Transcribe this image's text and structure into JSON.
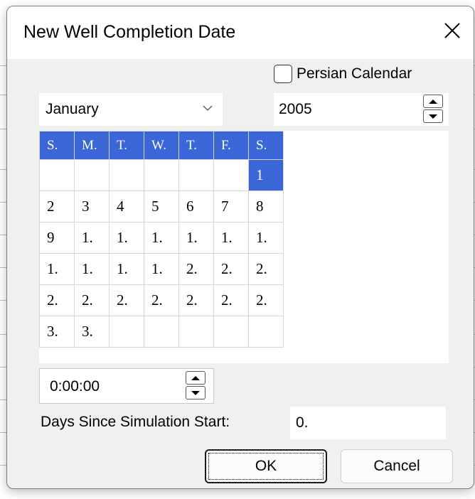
{
  "dialog": {
    "title": "New Well Completion Date",
    "close_icon": "close-icon"
  },
  "persian_calendar": {
    "label": "Persian Calendar",
    "checked": false
  },
  "month": {
    "value": "January",
    "icon": "chevron-down-icon"
  },
  "year": {
    "value": "2005",
    "up_icon": "spin-up-icon",
    "down_icon": "spin-down-icon"
  },
  "calendar": {
    "weekdays": [
      "S.",
      "M.",
      "T.",
      "W.",
      "T.",
      "F.",
      "S."
    ],
    "weeks": [
      [
        "",
        "",
        "",
        "",
        "",
        "",
        "1"
      ],
      [
        "2",
        "3",
        "4",
        "5",
        "6",
        "7",
        "8"
      ],
      [
        "9",
        "1.",
        "1.",
        "1.",
        "1.",
        "1.",
        "1."
      ],
      [
        "1.",
        "1.",
        "1.",
        "1.",
        "2.",
        "2.",
        "2."
      ],
      [
        "2.",
        "2.",
        "2.",
        "2.",
        "2.",
        "2.",
        "2."
      ],
      [
        "3.",
        "3.",
        "",
        "",
        "",
        "",
        ""
      ]
    ],
    "selected_day": "1",
    "accent_color": "#3a66d8"
  },
  "time": {
    "value": "0:00:00"
  },
  "days_since_start": {
    "label": "Days Since Simulation Start:",
    "value": "0."
  },
  "buttons": {
    "ok": "OK",
    "cancel": "Cancel"
  }
}
